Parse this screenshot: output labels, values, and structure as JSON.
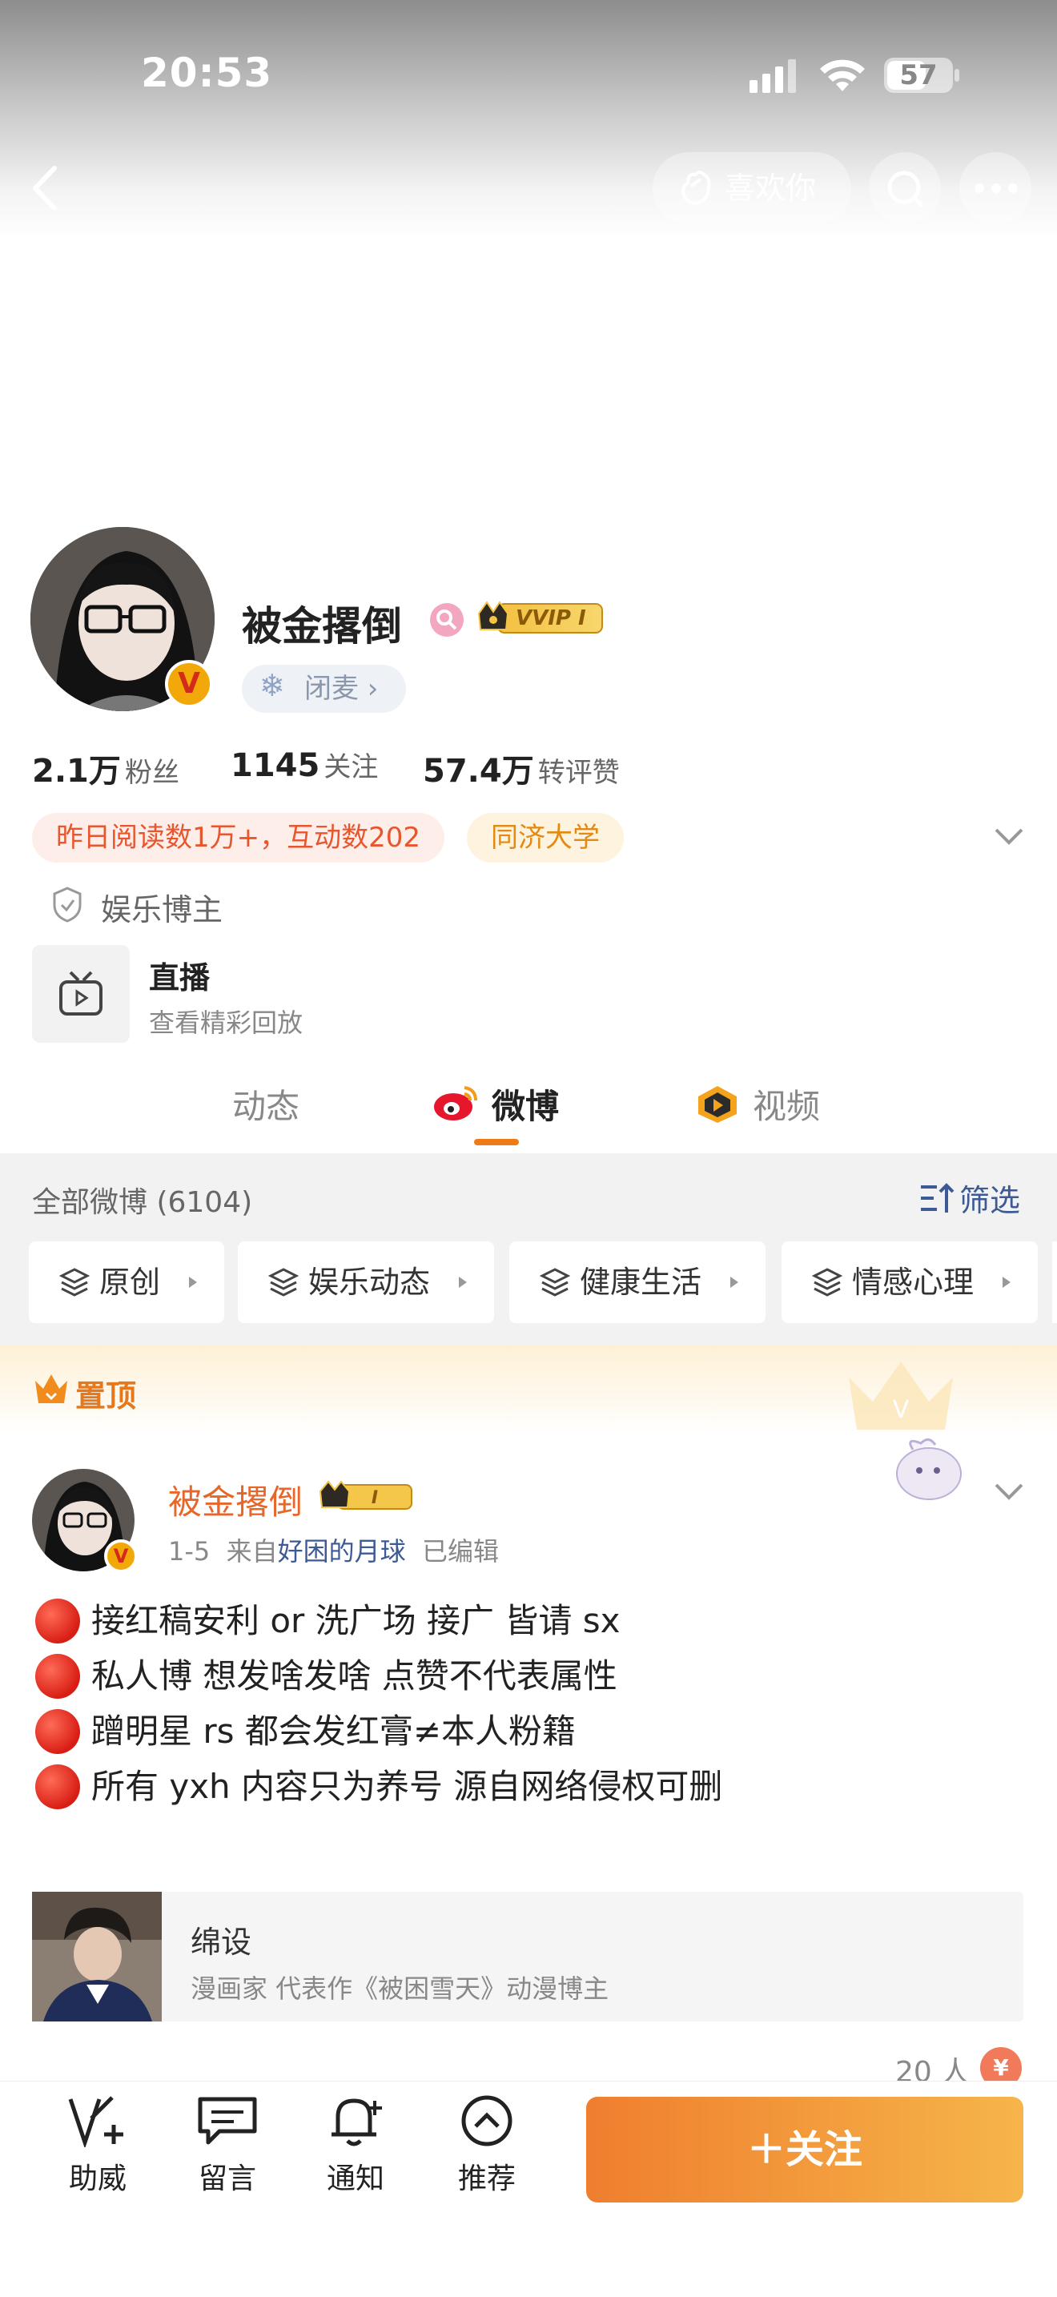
{
  "status_bar": {
    "time": "20:53",
    "battery": "57"
  },
  "top_bar": {
    "like_button": "喜欢你"
  },
  "profile": {
    "name": "被金撂倒",
    "vip_text": "VVIP I",
    "status_chip": "闭麦 ›"
  },
  "stats": [
    {
      "num": "2.1万",
      "label": "粉丝"
    },
    {
      "num": "1145",
      "label": "关注"
    },
    {
      "num": "57.4万",
      "label": "转评赞"
    }
  ],
  "tags": [
    "昨日阅读数1万+，互动数202",
    "同济大学"
  ],
  "category": "娱乐博主",
  "live": {
    "title": "直播",
    "subtitle": "查看精彩回放"
  },
  "tabs": [
    "动态",
    "微博",
    "视频"
  ],
  "filter_bar": {
    "total": "全部微博 (6104)",
    "filter": "筛选"
  },
  "chips": [
    "原创",
    "娱乐动态",
    "健康生活",
    "情感心理"
  ],
  "pinned_label": "置顶",
  "post": {
    "author": "被金撂倒",
    "meta_date": "1-5",
    "meta_from": "来自",
    "meta_source": "好困的月球",
    "meta_edited": "已编辑",
    "lines": [
      "接红稿安利 or 洗广场 接广 皆请 sx",
      "私人博 想发啥发啥 点赞不代表属性",
      "蹭明星 rs 都会发红膏≠本人粉籍",
      "所有 yxh 内容只为养号 源自网络侵权可删"
    ],
    "card": {
      "title": "绵设",
      "subtitle": "漫画家 代表作《被困雪天》动漫博主"
    },
    "people": "20 人"
  },
  "bottom_nav": [
    "助威",
    "留言",
    "通知",
    "推荐"
  ],
  "follow_button": "＋关注",
  "colors": {
    "accent": "#f07a16",
    "follow_start": "#ef7e2e",
    "follow_end": "#f6b54a",
    "blue_link": "#3d5a96"
  }
}
